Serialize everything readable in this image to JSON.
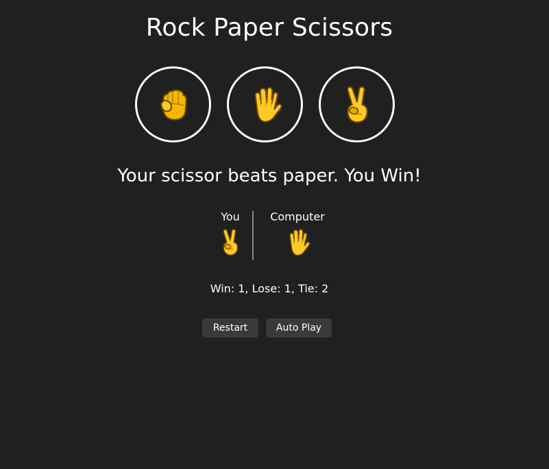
{
  "title": "Rock Paper Scissors",
  "choices": [
    {
      "name": "rock",
      "icon": "fist-icon"
    },
    {
      "name": "paper",
      "icon": "raised-hand-icon"
    },
    {
      "name": "scissors",
      "icon": "victory-hand-icon"
    }
  ],
  "result": "Your scissor beats paper. You Win!",
  "moves": {
    "you_label": "You",
    "you_icon": "victory-hand-icon",
    "computer_label": "Computer",
    "computer_icon": "raised-hand-icon"
  },
  "score": "Win: 1, Lose: 1, Tie: 2",
  "buttons": {
    "restart": "Restart",
    "auto_play": "Auto Play"
  },
  "colors": {
    "background": "#202020",
    "emoji_yellow": "#FFCA28",
    "button_bg": "#3A3A3A"
  }
}
